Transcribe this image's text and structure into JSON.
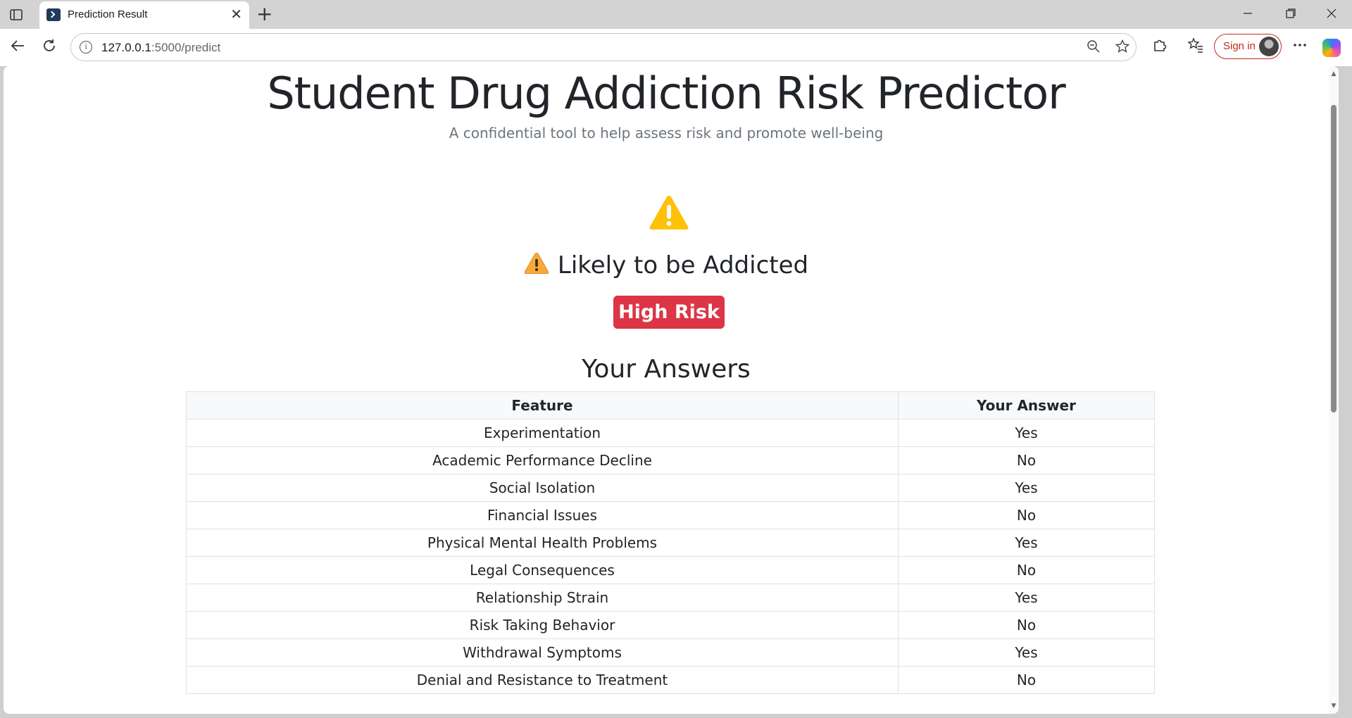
{
  "browser": {
    "tab_title": "Prediction Result",
    "tab_close": "✕",
    "new_tab": "+",
    "url_host": "127.0.0.1",
    "url_path": ":5000/predict",
    "sign_in_label": "Sign in",
    "icons": [
      "sidebar-toggle-icon",
      "terminal-icon",
      "back-icon",
      "reload-icon",
      "info-icon",
      "zoom-out-icon",
      "star-icon",
      "extensions-icon",
      "favorites-icon",
      "more-icon",
      "copilot-icon"
    ]
  },
  "page": {
    "title": "Student Drug Addiction Risk Predictor",
    "subtitle": "A confidential tool to help assess risk and promote well-being",
    "prediction": "Likely to be Addicted",
    "risk_label": "High Risk",
    "answers_heading": "Your Answers"
  },
  "table": {
    "headers": [
      "Feature",
      "Your Answer"
    ],
    "rows": [
      [
        "Experimentation",
        "Yes"
      ],
      [
        "Academic Performance Decline",
        "No"
      ],
      [
        "Social Isolation",
        "Yes"
      ],
      [
        "Financial Issues",
        "No"
      ],
      [
        "Physical Mental Health Problems",
        "Yes"
      ],
      [
        "Legal Consequences",
        "No"
      ],
      [
        "Relationship Strain",
        "Yes"
      ],
      [
        "Risk Taking Behavior",
        "No"
      ],
      [
        "Withdrawal Symptoms",
        "Yes"
      ],
      [
        "Denial and Resistance to Treatment",
        "No"
      ]
    ]
  },
  "colors": {
    "warning": "#ffc107",
    "danger": "#dc3545",
    "text": "#212529",
    "muted": "#6c757d"
  }
}
